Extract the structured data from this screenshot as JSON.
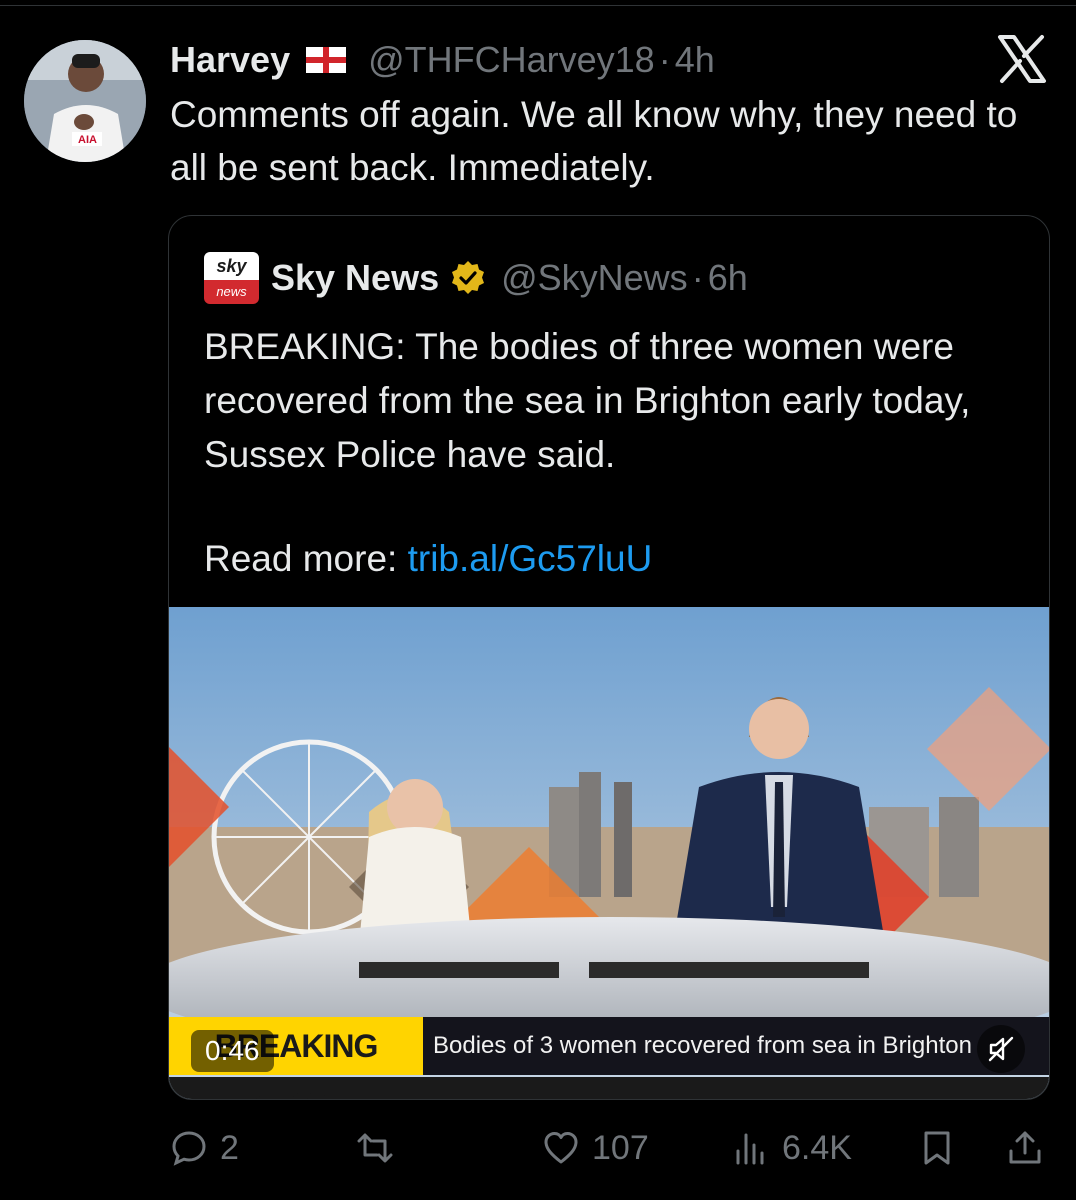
{
  "author": {
    "display_name": "Harvey",
    "flag": "england-flag-icon",
    "handle": "@THFCHarvey18",
    "separator": "·",
    "time": "4h",
    "avatar": "avatar"
  },
  "tweet": {
    "text": "Comments off again. We all know why, they need to all be sent back. Immediately."
  },
  "platform_logo": "x-logo",
  "quote": {
    "logo_top": "sky",
    "logo_bottom": "news",
    "display_name": "Sky News",
    "verified": "verified-gold-icon",
    "handle": "@SkyNews",
    "separator": "·",
    "time": "6h",
    "text": "BREAKING: The bodies of three women were recovered from the sea in Brighton early today, Sussex Police have said.",
    "read_more_label": "Read more:",
    "link": "trib.al/Gc57luU",
    "video": {
      "ticker_label": "BREAKING NEWS",
      "ticker_headline": "Bodies of 3 women recovered from sea in Brighton",
      "duration": "0:46",
      "mute_icon": "speaker-muted-icon"
    }
  },
  "actions": {
    "replies": "2",
    "retweets": "",
    "likes": "107",
    "views": "6.4K"
  },
  "colors": {
    "background": "#000000",
    "text": "#e7e9ea",
    "muted": "#71767b",
    "link": "#1d9bf0",
    "border": "#2f3336",
    "ticker_yellow": "#ffd400"
  }
}
